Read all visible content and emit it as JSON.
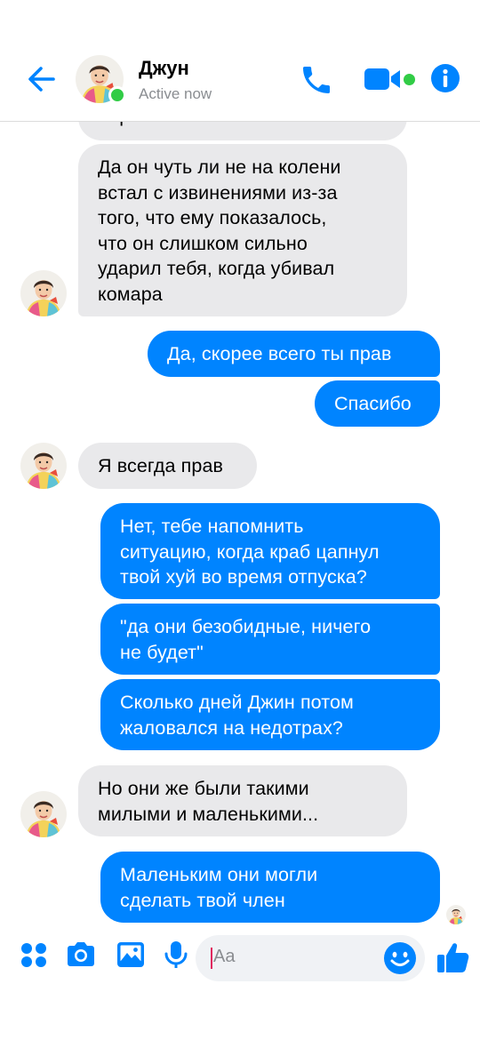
{
  "header": {
    "name": "Джун",
    "status": "Active now"
  },
  "messages": [
    {
      "dir": "in",
      "text": "бережет"
    },
    {
      "dir": "in",
      "text": "Да он чуть ли не на колени\nвстал с извинениями из-за\nтого, что ему показалось,\nчто он слишком сильно\nударил тебя, когда убивал\nкомара"
    },
    {
      "dir": "out",
      "text": "Да, скорее всего ты прав"
    },
    {
      "dir": "out",
      "text": "Спасибо"
    },
    {
      "dir": "in",
      "text": "Я всегда прав"
    },
    {
      "dir": "out",
      "text": "Нет, тебе напомнить\nситуацию, когда краб цапнул\nтвой хуй во время отпуска?"
    },
    {
      "dir": "out",
      "text": "\"да они безобидные, ничего\nне будет\""
    },
    {
      "dir": "out",
      "text": "Сколько дней Джин потом\nжаловался на недотрах?"
    },
    {
      "dir": "in",
      "text": "Но они же были такими\nмилыми и маленькими..."
    },
    {
      "dir": "out",
      "text": "Маленьким они могли\nсделать твой член"
    }
  ],
  "composer": {
    "placeholder": "Aa"
  },
  "colors": {
    "accent": "#0084ff",
    "incoming_bubble": "#e9e9eb",
    "online": "#31cc46"
  },
  "icons": {
    "back": "arrow-left-icon",
    "call": "phone-icon",
    "video": "video-camera-icon",
    "info": "info-icon",
    "apps": "four-dots-icon",
    "camera": "camera-icon",
    "gallery": "image-icon",
    "mic": "microphone-icon",
    "emoji": "smiley-icon",
    "like": "thumbs-up-icon"
  }
}
